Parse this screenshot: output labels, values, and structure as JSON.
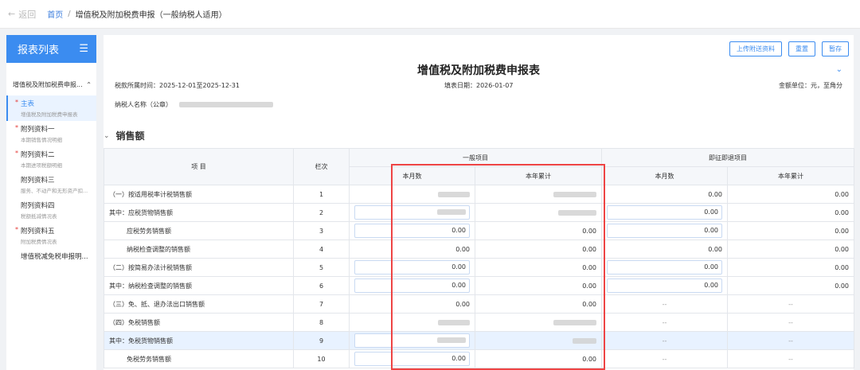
{
  "topbar": {
    "back_label": "返回",
    "home": "首页",
    "sep": "/",
    "current": "增值税及附加税费申报（一般纳税人适用）"
  },
  "sidebar": {
    "title": "报表列表",
    "group_label": "增值税及附加税费申报...",
    "items": [
      {
        "title": "主表",
        "subtitle": "增值税及附加税费申报表",
        "required": true,
        "active": true
      },
      {
        "title": "附列资料一",
        "subtitle": "本期销售情况明细",
        "required": true
      },
      {
        "title": "附列资料二",
        "subtitle": "本期进项税额明细",
        "required": true
      },
      {
        "title": "附列资料三",
        "subtitle": "服务、不动产和无形资产扣...",
        "required": false
      },
      {
        "title": "附列资料四",
        "subtitle": "税额抵减情况表",
        "required": false
      },
      {
        "title": "附列资料五",
        "subtitle": "附加税费情况表",
        "required": true
      },
      {
        "title": "增值税减免税申报明...",
        "subtitle": "",
        "required": false
      }
    ]
  },
  "toolbar": {
    "upload": "上传附送资料",
    "reset": "重置",
    "save": "暂存"
  },
  "form": {
    "title": "增值税及附加税费申报表",
    "period": "税款所属时间：2025-12-01至2025-12-31",
    "fill_date": "填表日期：2026-01-07",
    "unit": "金额单位：元，至角分",
    "taxpayer_label": "纳税人名称（公章）"
  },
  "section_title": "销售额",
  "table": {
    "headers": {
      "item": "项 目",
      "col": "栏次",
      "general": "一般项目",
      "instant": "即征即退项目",
      "month": "本月数",
      "year": "本年累计"
    },
    "rows": [
      {
        "item": "（一）按适用税率计税销售额",
        "col": "1",
        "g_m": "",
        "g_y": "",
        "i_m": "0.00",
        "i_y": "0.00"
      },
      {
        "item": "其中：应税货物销售额",
        "col": "2",
        "g_m": "",
        "g_y": "",
        "i_m": "0.00",
        "i_y": "0.00"
      },
      {
        "item": "应税劳务销售额",
        "col": "3",
        "g_m": "0.00",
        "g_y": "0.00",
        "i_m": "0.00",
        "i_y": "0.00"
      },
      {
        "item": "纳税检查调整的销售额",
        "col": "4",
        "g_m": "0.00",
        "g_y": "0.00",
        "i_m": "0.00",
        "i_y": "0.00"
      },
      {
        "item": "（二）按简易办法计税销售额",
        "col": "5",
        "g_m": "0.00",
        "g_y": "0.00",
        "i_m": "0.00",
        "i_y": "0.00"
      },
      {
        "item": "其中：纳税检查调整的销售额",
        "col": "6",
        "g_m": "0.00",
        "g_y": "0.00",
        "i_m": "0.00",
        "i_y": "0.00"
      },
      {
        "item": "（三）免、抵、退办法出口销售额",
        "col": "7",
        "g_m": "0.00",
        "g_y": "0.00",
        "i_m": "--",
        "i_y": "--"
      },
      {
        "item": "（四）免税销售额",
        "col": "8",
        "g_m": "",
        "g_y": "",
        "i_m": "--",
        "i_y": "--"
      },
      {
        "item": "其中：免税货物销售额",
        "col": "9",
        "g_m": "",
        "g_y": "",
        "i_m": "--",
        "i_y": "--"
      },
      {
        "item": "免税劳务销售额",
        "col": "10",
        "g_m": "0.00",
        "g_y": "0.00",
        "i_m": "--",
        "i_y": "--"
      }
    ]
  }
}
